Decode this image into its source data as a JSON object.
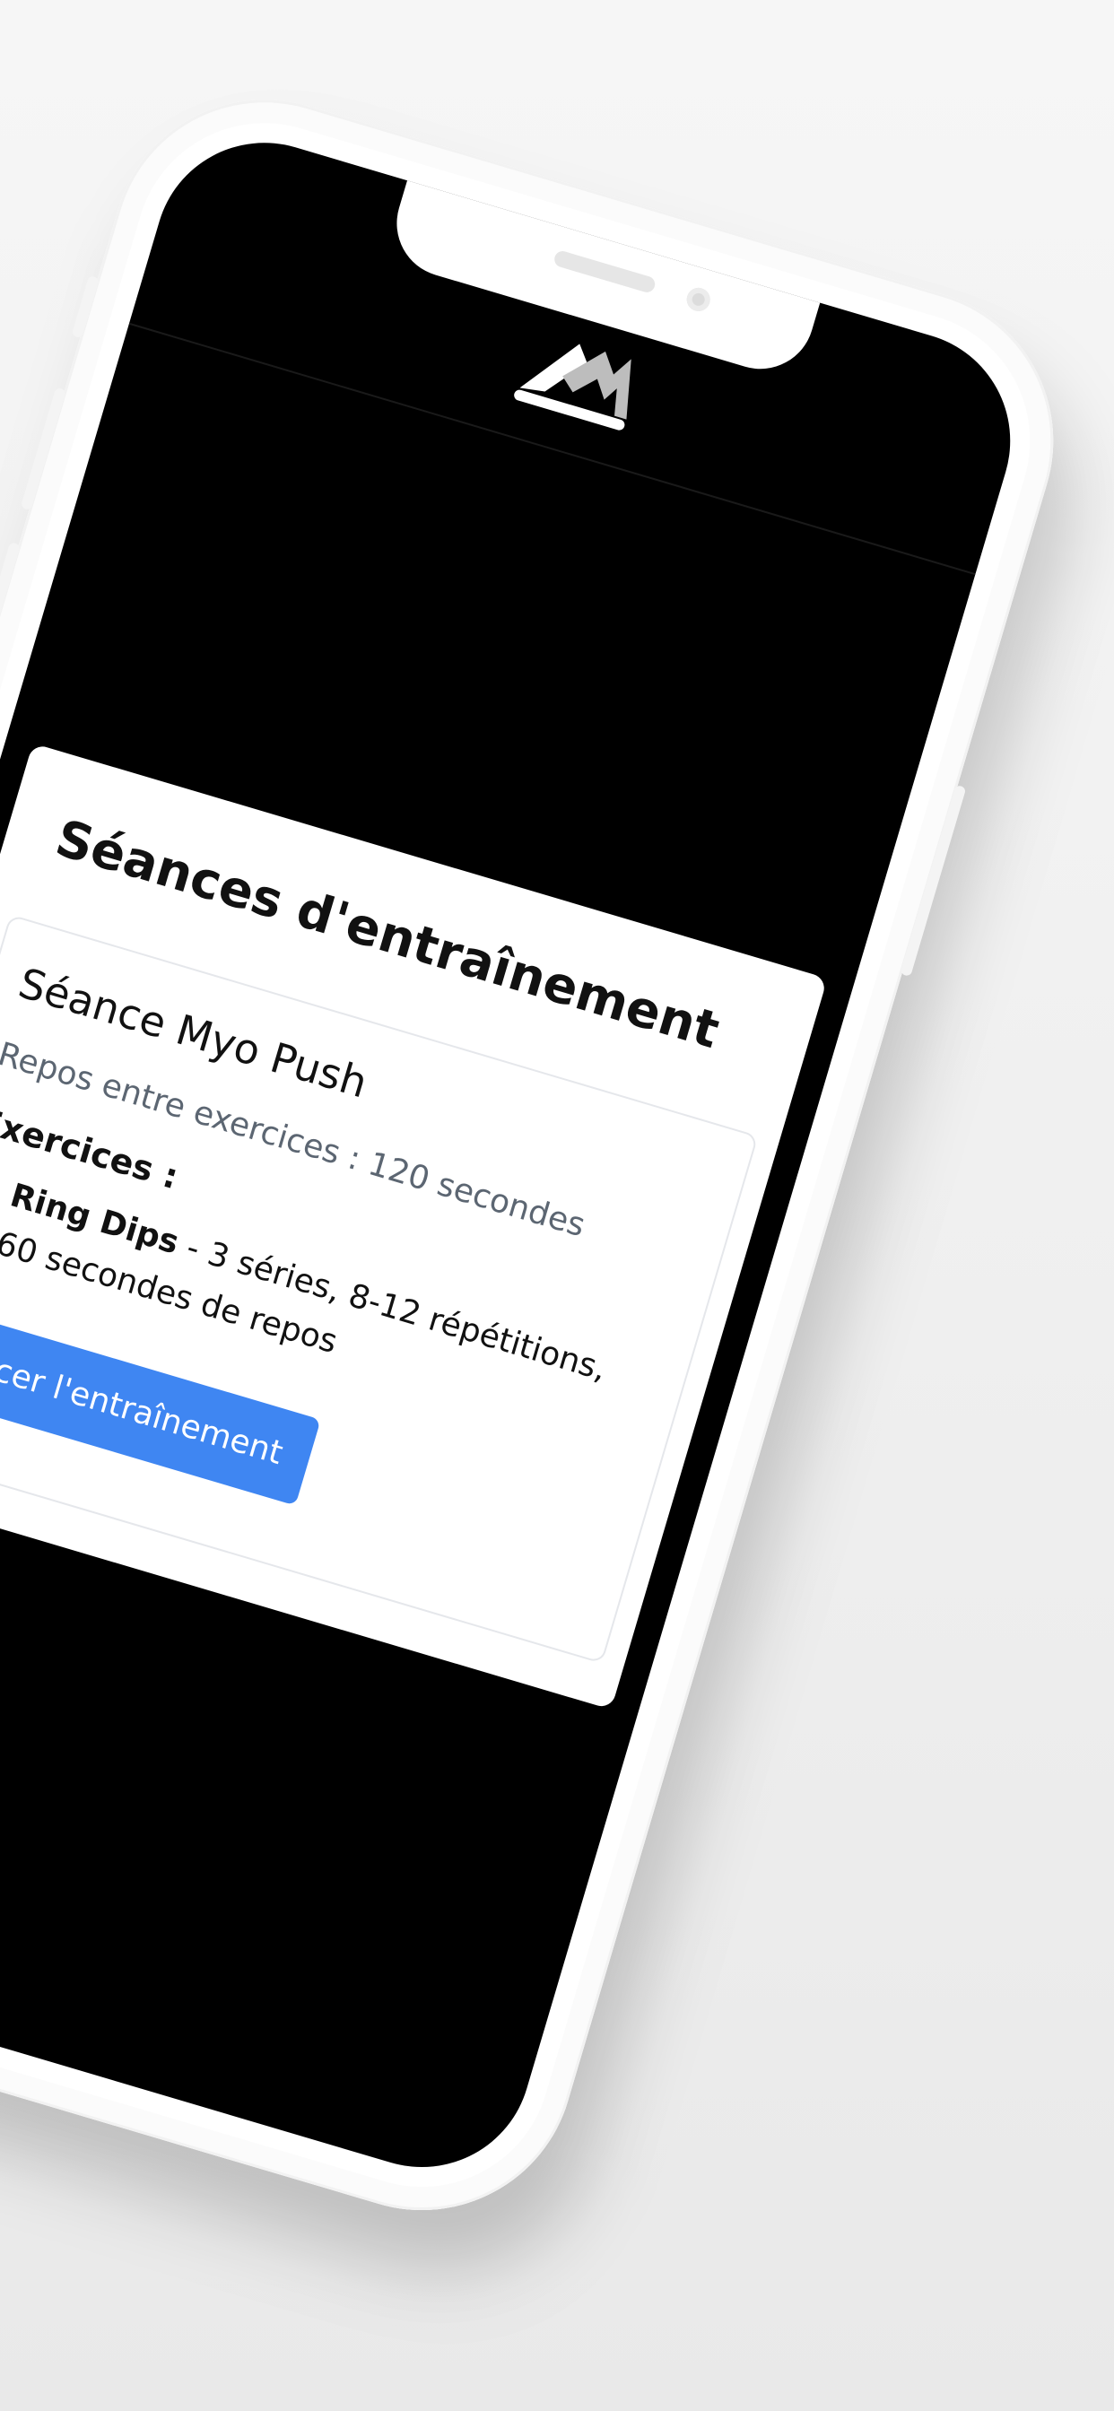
{
  "section": {
    "title": "Séances d'entraînement"
  },
  "session": {
    "name": "Séance Myo Push",
    "rest_between_exercises": "Repos entre exercices : 120 secondes",
    "exercises_label": "Exercices :",
    "exercises": [
      {
        "name": "Ring Dips",
        "detail": " - 3 séries, 8-12 répétitions, 60 secondes de repos"
      }
    ],
    "launch_label": "Lancer l'entraînement"
  },
  "colors": {
    "accent": "#3f86f2",
    "screen_background": "#000000",
    "muted_text": "#5c6672"
  },
  "icons": {
    "logo": "app-logo-icon"
  }
}
